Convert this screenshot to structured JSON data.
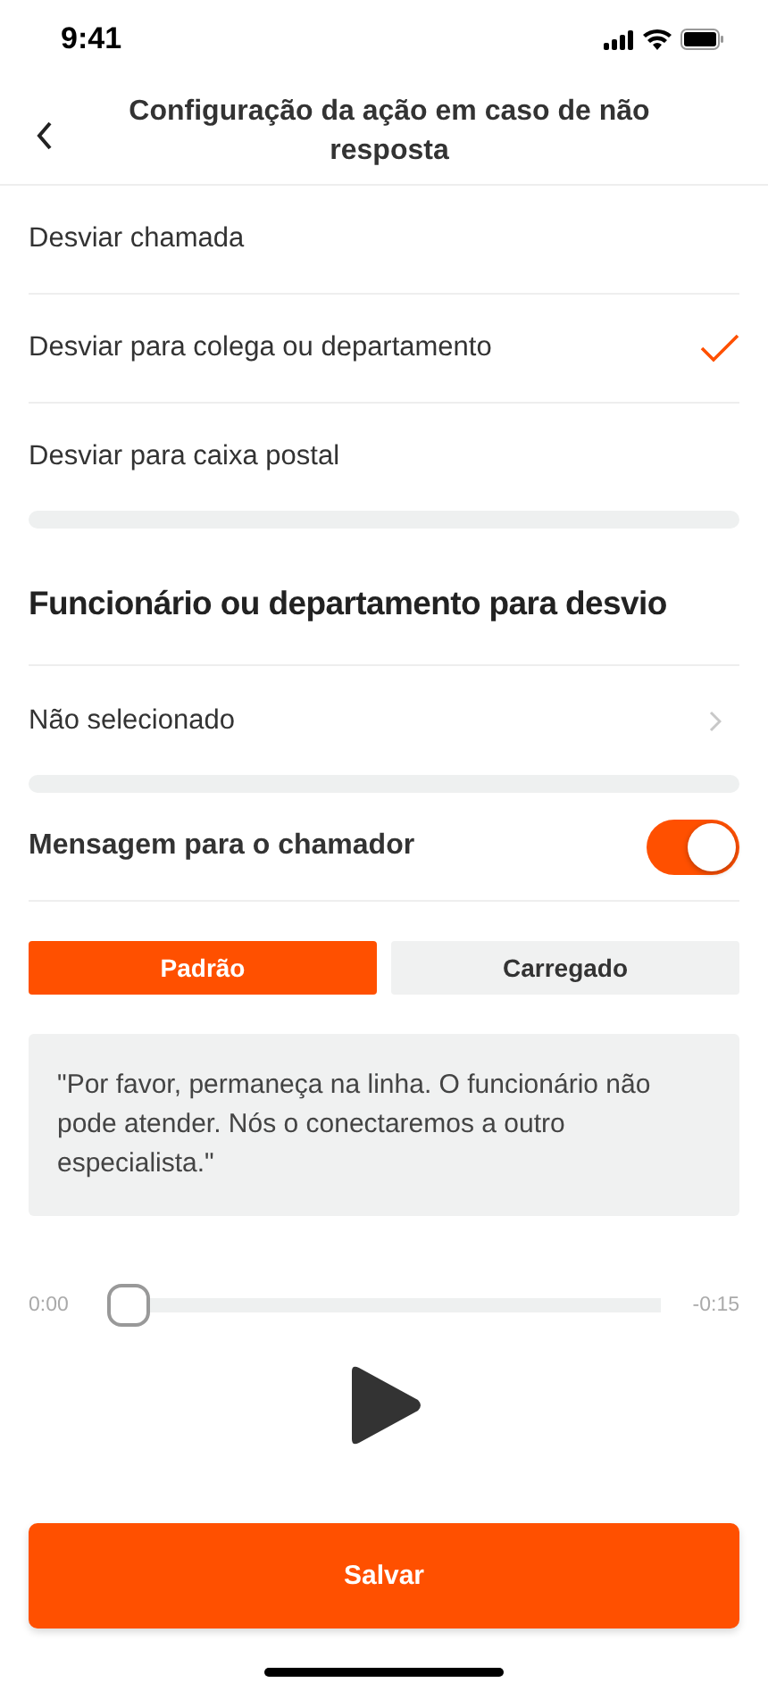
{
  "status_bar": {
    "time": "9:41"
  },
  "header": {
    "title": "Configuração da ação em caso de não resposta"
  },
  "options": [
    {
      "label": "Desviar chamada",
      "selected": false
    },
    {
      "label": "Desviar para colega ou departamento",
      "selected": true
    },
    {
      "label": "Desviar para caixa postal",
      "selected": false
    }
  ],
  "target_section": {
    "heading": "Funcionário ou departamento para desvio",
    "value": "Não selecionado"
  },
  "caller_message": {
    "label": "Mensagem para o chamador",
    "on": true
  },
  "message_tabs": [
    {
      "label": "Padrão",
      "selected": true
    },
    {
      "label": "Carregado",
      "selected": false
    }
  ],
  "message_text": "\"Por favor, permaneça na linha. O funcionário não pode atender. Nós o conectaremos a outro especialista.\"",
  "player": {
    "elapsed": "0:00",
    "remaining": "-0:15",
    "level": 0
  },
  "save_button": "Salvar"
}
